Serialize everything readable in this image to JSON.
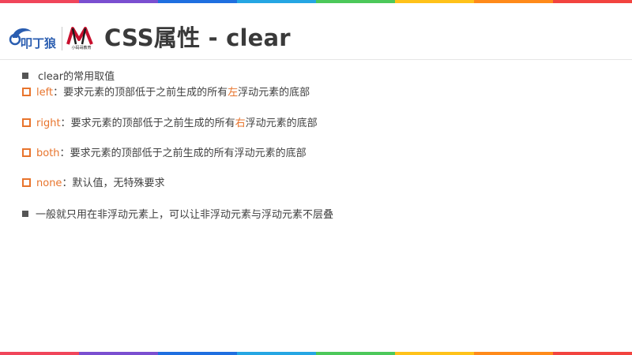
{
  "title": "CSS属性 - clear",
  "logos": {
    "brand_mark": "叩丁狼",
    "partner_text": "小码哥教育"
  },
  "colors": {
    "accent": "#e8742c",
    "text": "#404040"
  },
  "intro": "clear的常用取值",
  "items": [
    {
      "kw": "left",
      "sep": "：",
      "pre": "要求元素的顶部低于之前生成的所有",
      "hl": "左",
      "post": "浮动元素的底部"
    },
    {
      "kw": "right",
      "sep": "：",
      "pre": "要求元素的顶部低于之前生成的所有",
      "hl": "右",
      "post": "浮动元素的底部"
    },
    {
      "kw": "both",
      "sep": "：",
      "pre": "要求元素的顶部低于之前生成的所有浮动元素的底部",
      "hl": "",
      "post": ""
    },
    {
      "kw": "none",
      "sep": "：",
      "pre": "默认值，无特殊要求",
      "hl": "",
      "post": ""
    }
  ],
  "note": "一般就只用在非浮动元素上，可以让非浮动元素与浮动元素不层叠"
}
